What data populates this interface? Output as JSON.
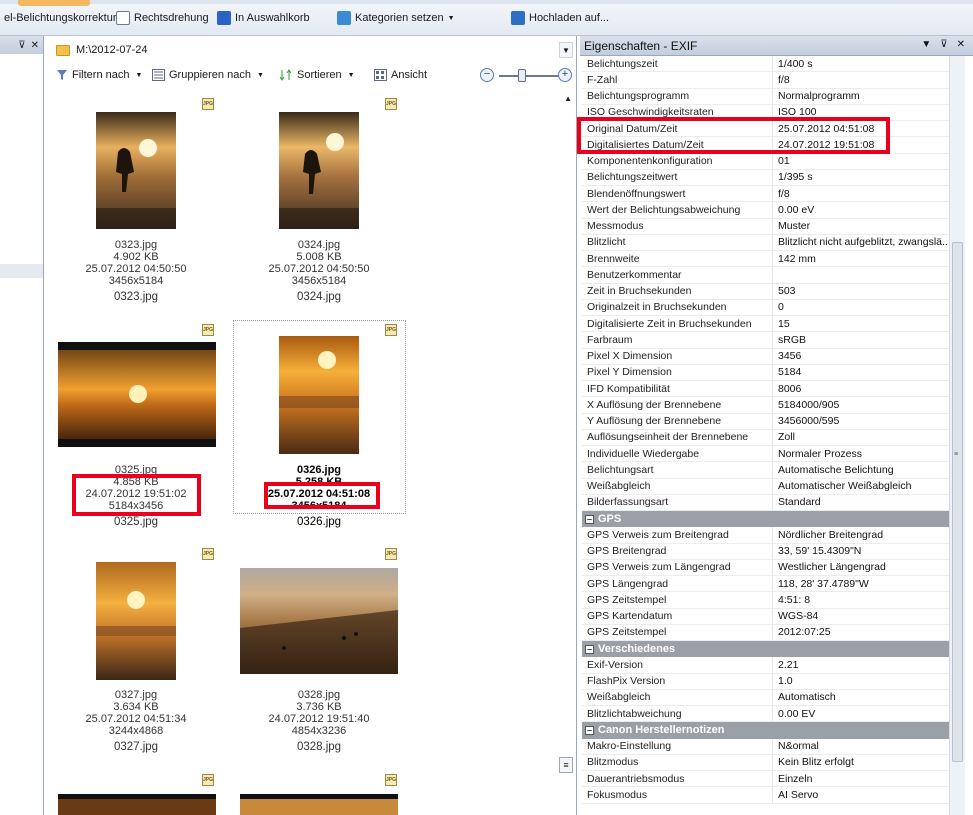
{
  "toolbar": {
    "item1": "el-Belichtungskorrektur",
    "item2": "Rechtsdrehung",
    "item3": "In Auswahlkorb",
    "item4": "Kategorien setzen",
    "item5": "Hochladen auf..."
  },
  "left_panel": {
    "pin": "❘",
    "close": "✕"
  },
  "browser": {
    "path": "M:\\2012-07-24",
    "filter": "Filtern nach",
    "group": "Gruppieren nach",
    "sort": "Sortieren",
    "view": "Ansicht",
    "zoom_minus": "−",
    "zoom_plus": "+",
    "badge": "JPG",
    "items": [
      {
        "name": "0323.jpg",
        "size": "4.902 KB",
        "date": "25.07.2012 04:50:50",
        "dim": "3456x5184",
        "name2": "0323.jpg"
      },
      {
        "name": "0324.jpg",
        "size": "5.008 KB",
        "date": "25.07.2012 04:50:50",
        "dim": "3456x5184",
        "name2": "0324.jpg"
      },
      {
        "name": "0325.jpg",
        "size": "4.858 KB",
        "date": "24.07.2012 19:51:02",
        "dim": "5184x3456",
        "name2": "0325.jpg"
      },
      {
        "name": "0326.jpg",
        "size": "5.258 KB",
        "date": "25.07.2012 04:51:08",
        "dim": "3456x5184",
        "name2": "0326.jpg"
      },
      {
        "name": "0327.jpg",
        "size": "3.634 KB",
        "date": "25.07.2012 04:51:34",
        "dim": "3244x4868",
        "name2": "0327.jpg"
      },
      {
        "name": "0328.jpg",
        "size": "3.736 KB",
        "date": "24.07.2012 19:51:40",
        "dim": "4854x3236",
        "name2": "0328.jpg"
      }
    ]
  },
  "props": {
    "title": "Eigenschaften - EXIF",
    "exif": [
      {
        "k": "Belichtungszeit",
        "v": "1/400 s"
      },
      {
        "k": "F-Zahl",
        "v": "f/8"
      },
      {
        "k": "Belichtungsprogramm",
        "v": "Normalprogramm"
      },
      {
        "k": "ISO Geschwindigkeitsraten",
        "v": "ISO 100"
      },
      {
        "k": "Original Datum/Zeit",
        "v": "25.07.2012 04:51:08"
      },
      {
        "k": "Digitalisiertes Datum/Zeit",
        "v": "24.07.2012 19:51:08"
      },
      {
        "k": "Komponentenkonfiguration",
        "v": "01"
      },
      {
        "k": "Belichtungszeitwert",
        "v": "1/395 s"
      },
      {
        "k": "Blendenöffnungswert",
        "v": "f/8"
      },
      {
        "k": "Wert der Belichtungsabweichung",
        "v": "0.00 eV"
      },
      {
        "k": "Messmodus",
        "v": "Muster"
      },
      {
        "k": "Blitzlicht",
        "v": "Blitzlicht nicht aufgeblitzt, zwangslä..."
      },
      {
        "k": "Brennweite",
        "v": "142 mm"
      },
      {
        "k": "Benutzerkommentar",
        "v": ""
      },
      {
        "k": "Zeit in Bruchsekunden",
        "v": "503"
      },
      {
        "k": "Originalzeit in Bruchsekunden",
        "v": "0"
      },
      {
        "k": "Digitalisierte Zeit in Bruchsekunden",
        "v": "15"
      },
      {
        "k": "Farbraum",
        "v": "sRGB"
      },
      {
        "k": "Pixel X Dimension",
        "v": "3456"
      },
      {
        "k": "Pixel Y Dimension",
        "v": "5184"
      },
      {
        "k": "IFD Kompatibilität",
        "v": "8006"
      },
      {
        "k": "X Auflösung der Brennebene",
        "v": "5184000/905"
      },
      {
        "k": "Y Auflösung der Brennebene",
        "v": "3456000/595"
      },
      {
        "k": "Auflösungseinheit der Brennebene",
        "v": "Zoll"
      },
      {
        "k": "Individuelle Wiedergabe",
        "v": "Normaler Prozess"
      },
      {
        "k": "Belichtungsart",
        "v": "Automatische Belichtung"
      },
      {
        "k": "Weißabgleich",
        "v": "Automatischer Weißabgleich"
      },
      {
        "k": "Bilderfassungsart",
        "v": "Standard"
      }
    ],
    "gps_title": "GPS",
    "gps": [
      {
        "k": "GPS Verweis zum Breitengrad",
        "v": "Nördlicher Breitengrad"
      },
      {
        "k": "GPS Breitengrad",
        "v": "33, 59' 15.4309\"N"
      },
      {
        "k": "GPS Verweis zum Längengrad",
        "v": "Westlicher Längengrad"
      },
      {
        "k": "GPS Längengrad",
        "v": "118, 28' 37.4789\"W"
      },
      {
        "k": "GPS Zeitstempel",
        "v": "4:51: 8"
      },
      {
        "k": "GPS Kartendatum",
        "v": "WGS-84"
      },
      {
        "k": "GPS Zeitstempel",
        "v": "2012:07:25"
      }
    ],
    "misc_title": "Verschiedenes",
    "misc": [
      {
        "k": "Exif-Version",
        "v": "2.21"
      },
      {
        "k": "FlashPix Version",
        "v": "1.0"
      },
      {
        "k": "Weißabgleich",
        "v": "Automatisch"
      },
      {
        "k": "Blitzlichtabweichung",
        "v": "0.00 EV"
      }
    ],
    "canon_title": "Canon Herstellernotizen",
    "canon": [
      {
        "k": "Makro-Einstellung",
        "v": "N&ormal"
      },
      {
        "k": "Blitzmodus",
        "v": "Kein Blitz erfolgt"
      },
      {
        "k": "Dauerantriebsmodus",
        "v": "Einzeln"
      },
      {
        "k": "Fokusmodus",
        "v": "AI Servo"
      }
    ]
  }
}
